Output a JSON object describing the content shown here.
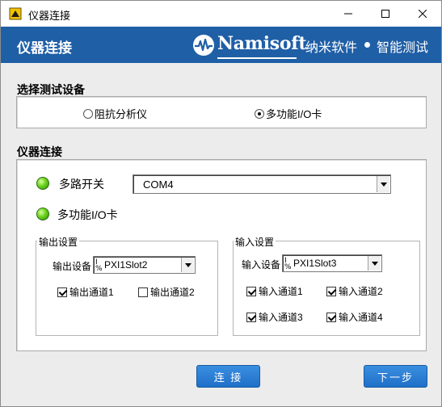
{
  "window": {
    "title": "仪器连接",
    "controls": {
      "minimize": "minimize-icon",
      "maximize": "maximize-icon",
      "close": "close-icon"
    }
  },
  "banner": {
    "title": "仪器连接",
    "brand_name": "Namisoft",
    "brand_cn": "纳米软件",
    "brand_slogan": "智能测试",
    "color": "#1f5fa6"
  },
  "device_select": {
    "title": "选择测试设备",
    "options": [
      {
        "label": "阻抗分析仪",
        "checked": false
      },
      {
        "label": "多功能I/O卡",
        "checked": true
      }
    ]
  },
  "connection": {
    "title": "仪器连接",
    "switch_label": "多路开关",
    "switch_port": "COM4",
    "io_label": "多功能I/O卡",
    "led_color": "#6bd21e",
    "output": {
      "group_label": "输出设置",
      "device_label": "输出设备",
      "device_value": "PXI1Slot2",
      "channels": [
        {
          "label": "输出通道1",
          "checked": true
        },
        {
          "label": "输出通道2",
          "checked": false
        }
      ]
    },
    "input": {
      "group_label": "输入设置",
      "device_label": "输入设备",
      "device_value": "PXI1Slot3",
      "channels": [
        {
          "label": "输入通道1",
          "checked": true
        },
        {
          "label": "输入通道2",
          "checked": true
        },
        {
          "label": "输入通道3",
          "checked": true
        },
        {
          "label": "输入通道4",
          "checked": true
        }
      ]
    }
  },
  "buttons": {
    "connect": "连 接",
    "next": "下一步"
  }
}
